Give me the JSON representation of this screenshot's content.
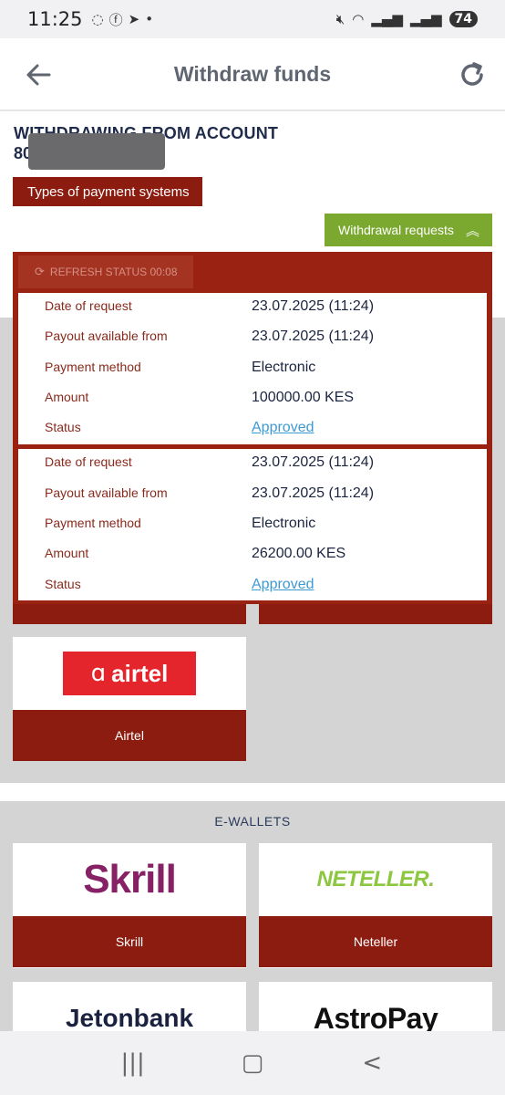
{
  "status_bar": {
    "time": "11:25",
    "battery": "74"
  },
  "header": {
    "title": "Withdraw funds"
  },
  "account": {
    "title": "WITHDRAWING FROM ACCOUNT",
    "number_prefix": "80"
  },
  "buttons": {
    "types_of_payment": "Types of payment systems",
    "withdrawal_requests": "Withdrawal requests",
    "refresh_status": "REFRESH STATUS 00:08"
  },
  "requests": [
    {
      "date_label": "Date of request",
      "date_value": "23.07.2025 (11:24)",
      "payout_label": "Payout available from",
      "payout_value": "23.07.2025 (11:24)",
      "method_label": "Payment method",
      "method_value": "Electronic",
      "amount_label": "Amount",
      "amount_value": "100000.00 KES",
      "status_label": "Status",
      "status_value": "Approved"
    },
    {
      "date_label": "Date of request",
      "date_value": "23.07.2025 (11:24)",
      "payout_label": "Payout available from",
      "payout_value": "23.07.2025 (11:24)",
      "method_label": "Payment method",
      "method_value": "Electronic",
      "amount_label": "Amount",
      "amount_value": "26200.00 KES",
      "status_label": "Status",
      "status_value": "Approved"
    }
  ],
  "mobile_payments": {
    "airtel_logo_text": "airtel",
    "airtel_label": "Airtel"
  },
  "ewallets": {
    "title": "E-WALLETS",
    "items": [
      {
        "logo_text": "Skrill",
        "label": "Skrill"
      },
      {
        "logo_text": "NETELLER.",
        "label": "Neteller"
      },
      {
        "logo_text": "Jetonbank",
        "label": ""
      },
      {
        "logo_text": "AstroPay",
        "label": ""
      }
    ]
  },
  "colors": {
    "brand_red": "#8c1c10",
    "green": "#7ba82f",
    "link": "#3d9ad3"
  }
}
